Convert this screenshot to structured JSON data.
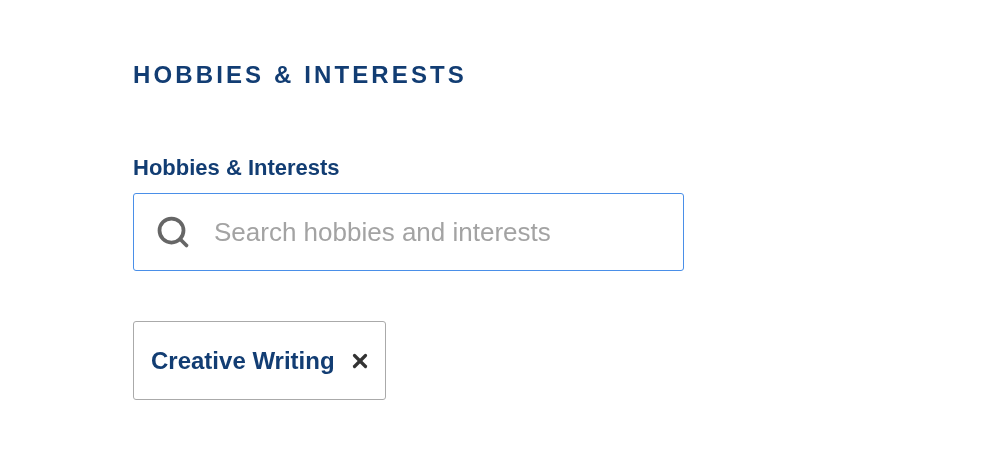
{
  "section": {
    "title": "HOBBIES & INTERESTS"
  },
  "field": {
    "label": "Hobbies & Interests",
    "placeholder": "Search hobbies and interests"
  },
  "tags": [
    {
      "label": "Creative Writing"
    }
  ]
}
